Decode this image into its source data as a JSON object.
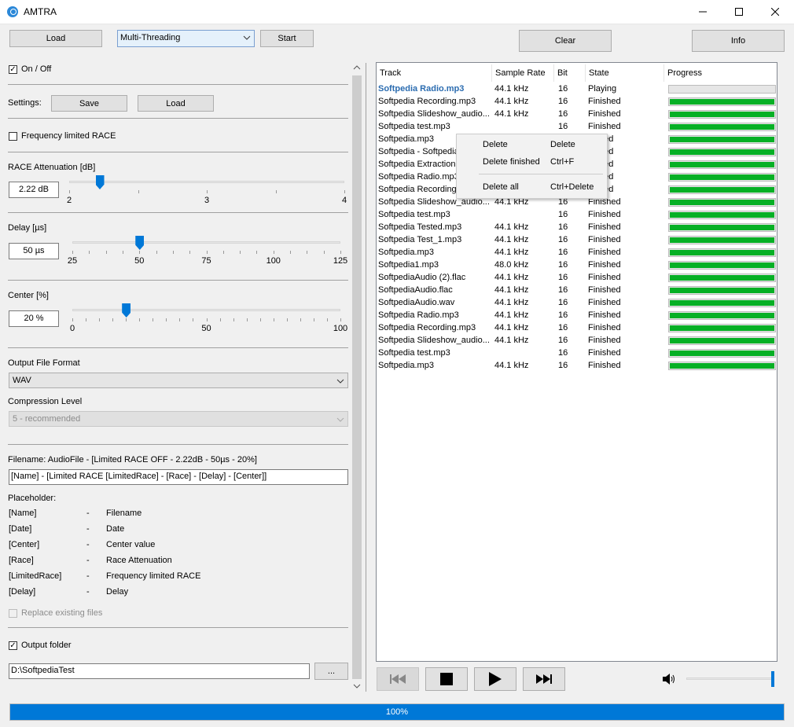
{
  "window": {
    "title": "AMTRA",
    "minimize": "—",
    "maximize": "☐",
    "close": "✕"
  },
  "toolbar": {
    "load_label": "Load",
    "mode_value": "Multi-Threading",
    "start_label": "Start",
    "clear_label": "Clear",
    "info_label": "Info"
  },
  "left": {
    "on_off_label": "On / Off",
    "settings_label": "Settings:",
    "settings_save": "Save",
    "settings_load": "Load",
    "freq_limited_label": "Frequency limited RACE",
    "race_att": {
      "label": "RACE Attenuation [dB]",
      "value": "2.22 dB",
      "ticks": [
        "2",
        "3",
        "4"
      ],
      "min": 2,
      "max": 4,
      "current": 2.22
    },
    "delay": {
      "label": "Delay [µs]",
      "value": "50 µs",
      "ticks": [
        "25",
        "50",
        "75",
        "100",
        "125"
      ],
      "min": 25,
      "max": 125,
      "current": 50
    },
    "center": {
      "label": "Center [%]",
      "value": "20 %",
      "ticks": [
        "0",
        "50",
        "100"
      ],
      "min": 0,
      "max": 100,
      "current": 20
    },
    "output_format_label": "Output File Format",
    "output_format_value": "WAV",
    "compression_label": "Compression Level",
    "compression_value": "5 - recommended",
    "filename_label": "Filename:  AudioFile - [Limited RACE OFF - 2.22dB - 50µs - 20%]",
    "filename_pattern": "[Name] - [Limited RACE [LimitedRace] - [Race] - [Delay] - [Center]]",
    "placeholder_label": "Placeholder:",
    "placeholders": [
      {
        "key": "[Name]",
        "dash": "-",
        "desc": "Filename"
      },
      {
        "key": "[Date]",
        "dash": "-",
        "desc": "Date"
      },
      {
        "key": "[Center]",
        "dash": "-",
        "desc": "Center value"
      },
      {
        "key": "[Race]",
        "dash": "-",
        "desc": "Race Attenuation"
      },
      {
        "key": "[LimitedRace]",
        "dash": "-",
        "desc": "Frequency limited RACE"
      },
      {
        "key": "[Delay]",
        "dash": "-",
        "desc": "Delay"
      }
    ],
    "replace_label": "Replace existing files",
    "output_folder_label": "Output folder",
    "output_folder_value": "D:\\SoftpediaTest",
    "browse_label": "..."
  },
  "list": {
    "columns": [
      "Track",
      "Sample Rate",
      "Bit",
      "State",
      "Progress"
    ],
    "rows": [
      {
        "track": "Softpedia Radio.mp3",
        "rate": "44.1 kHz",
        "bit": "16",
        "state": "Playing",
        "progress": 0,
        "active": true
      },
      {
        "track": "Softpedia Recording.mp3",
        "rate": "44.1 kHz",
        "bit": "16",
        "state": "Finished",
        "progress": 1
      },
      {
        "track": "Softpedia Slideshow_audio...",
        "rate": "44.1 kHz",
        "bit": "16",
        "state": "Finished",
        "progress": 1
      },
      {
        "track": "Softpedia test.mp3",
        "rate": "",
        "bit": "16",
        "state": "Finished",
        "progress": 1
      },
      {
        "track": "Softpedia.mp3",
        "rate": "",
        "bit": "",
        "state": "nished",
        "progress": 1
      },
      {
        "track": "Softpedia - Softpedia",
        "rate": "",
        "bit": "",
        "state": "nished",
        "progress": 1
      },
      {
        "track": "Softpedia Extraction",
        "rate": "",
        "bit": "",
        "state": "nished",
        "progress": 1
      },
      {
        "track": "Softpedia Radio.mp3",
        "rate": "",
        "bit": "",
        "state": "nished",
        "progress": 1
      },
      {
        "track": "Softpedia Recording",
        "rate": "",
        "bit": "",
        "state": "nished",
        "progress": 1
      },
      {
        "track": "Softpedia Slideshow_audio...",
        "rate": "44.1 kHz",
        "bit": "16",
        "state": "Finished",
        "progress": 1
      },
      {
        "track": "Softpedia test.mp3",
        "rate": "",
        "bit": "16",
        "state": "Finished",
        "progress": 1
      },
      {
        "track": "Softpedia Tested.mp3",
        "rate": "44.1 kHz",
        "bit": "16",
        "state": "Finished",
        "progress": 1
      },
      {
        "track": "Softpedia Test_1.mp3",
        "rate": "44.1 kHz",
        "bit": "16",
        "state": "Finished",
        "progress": 1
      },
      {
        "track": "Softpedia.mp3",
        "rate": "44.1 kHz",
        "bit": "16",
        "state": "Finished",
        "progress": 1
      },
      {
        "track": "Softpedia1.mp3",
        "rate": "48.0 kHz",
        "bit": "16",
        "state": "Finished",
        "progress": 1
      },
      {
        "track": "SoftpediaAudio (2).flac",
        "rate": "44.1 kHz",
        "bit": "16",
        "state": "Finished",
        "progress": 1
      },
      {
        "track": "SoftpediaAudio.flac",
        "rate": "44.1 kHz",
        "bit": "16",
        "state": "Finished",
        "progress": 1
      },
      {
        "track": "SoftpediaAudio.wav",
        "rate": "44.1 kHz",
        "bit": "16",
        "state": "Finished",
        "progress": 1
      },
      {
        "track": "Softpedia Radio.mp3",
        "rate": "44.1 kHz",
        "bit": "16",
        "state": "Finished",
        "progress": 1
      },
      {
        "track": "Softpedia Recording.mp3",
        "rate": "44.1 kHz",
        "bit": "16",
        "state": "Finished",
        "progress": 1
      },
      {
        "track": "Softpedia Slideshow_audio...",
        "rate": "44.1 kHz",
        "bit": "16",
        "state": "Finished",
        "progress": 1
      },
      {
        "track": "Softpedia test.mp3",
        "rate": "",
        "bit": "16",
        "state": "Finished",
        "progress": 1
      },
      {
        "track": "Softpedia.mp3",
        "rate": "44.1 kHz",
        "bit": "16",
        "state": "Finished",
        "progress": 1
      }
    ]
  },
  "context_menu": {
    "items": [
      {
        "label": "Delete",
        "shortcut": "Delete"
      },
      {
        "label": "Delete finished",
        "shortcut": "Ctrl+F"
      },
      {
        "label": "Delete all",
        "shortcut": "Ctrl+Delete"
      }
    ]
  },
  "player": {
    "volume_level": 1.0
  },
  "status": {
    "progress_text": "100%",
    "progress": 1.0
  },
  "colors": {
    "accent": "#0078d7",
    "progress_green": "#06b025",
    "active_track": "#2b6cb0"
  }
}
